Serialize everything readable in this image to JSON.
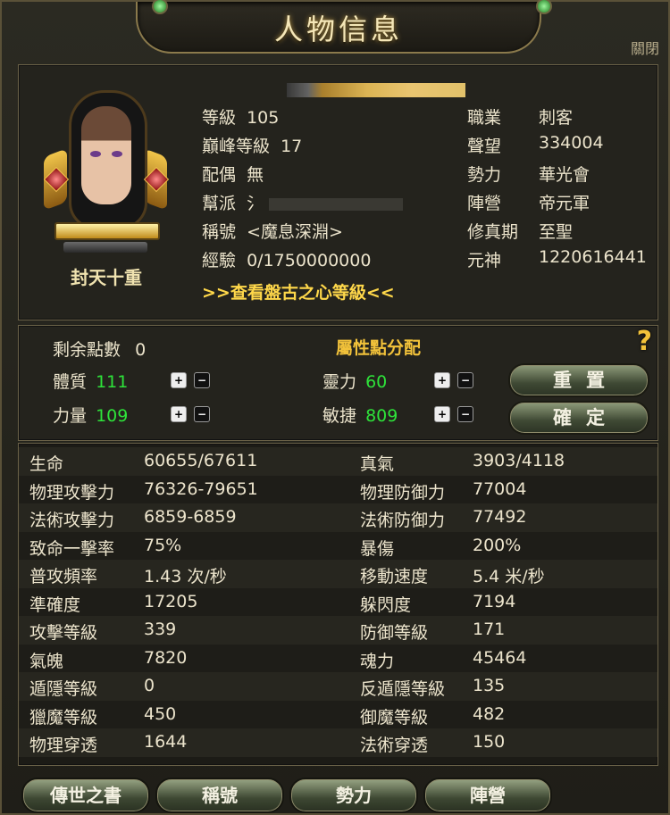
{
  "window": {
    "title": "人物信息",
    "close_label": "關閉"
  },
  "profile": {
    "rank_label": "封天十重",
    "left_fields": [
      {
        "label": "等級",
        "value": "105"
      },
      {
        "label": "巔峰等級",
        "value": "17"
      },
      {
        "label": "配偶",
        "value": "無"
      },
      {
        "label": "幫派",
        "value": "氵"
      },
      {
        "label": "稱號",
        "value": "<魔息深淵>"
      },
      {
        "label": "經驗",
        "value": "0/1750000000"
      }
    ],
    "right_fields": [
      {
        "label": "職業",
        "value": "刺客"
      },
      {
        "label": "聲望",
        "value": "334004"
      },
      {
        "label": "勢力",
        "value": "華光會"
      },
      {
        "label": "陣營",
        "value": "帝元軍"
      },
      {
        "label": "修真期",
        "value": "至聖"
      },
      {
        "label": "元神",
        "value": "1220616441"
      }
    ],
    "pangu_link": ">>查看盤古之心等級<<"
  },
  "attributes": {
    "remaining_label": "剩余點數",
    "remaining_value": "0",
    "section_title": "屬性點分配",
    "items": [
      {
        "label": "體質",
        "value": "111"
      },
      {
        "label": "力量",
        "value": "109"
      },
      {
        "label": "靈力",
        "value": "60"
      },
      {
        "label": "敏捷",
        "value": "809"
      }
    ],
    "plus": "+",
    "minus": "−",
    "help": "?",
    "reset_label": "重置",
    "confirm_label": "確定"
  },
  "stats": [
    {
      "l1": "生命",
      "v1": "60655/67611",
      "l2": "真氣",
      "v2": "3903/4118"
    },
    {
      "l1": "物理攻擊力",
      "v1": "76326-79651",
      "l2": "物理防御力",
      "v2": "77004"
    },
    {
      "l1": "法術攻擊力",
      "v1": "6859-6859",
      "l2": "法術防御力",
      "v2": "77492"
    },
    {
      "l1": "致命一擊率",
      "v1": "75%",
      "l2": "暴傷",
      "v2": "200%"
    },
    {
      "l1": "普攻頻率",
      "v1": "1.43 次/秒",
      "l2": "移動速度",
      "v2": "5.4 米/秒"
    },
    {
      "l1": "準確度",
      "v1": "17205",
      "l2": "躲閃度",
      "v2": "7194"
    },
    {
      "l1": "攻擊等級",
      "v1": "339",
      "l2": "防御等級",
      "v2": "171"
    },
    {
      "l1": "氣魄",
      "v1": "7820",
      "l2": "魂力",
      "v2": "45464"
    },
    {
      "l1": "遁隱等級",
      "v1": "0",
      "l2": "反遁隱等級",
      "v2": "135"
    },
    {
      "l1": "獵魔等級",
      "v1": "450",
      "l2": "御魔等級",
      "v2": "482"
    },
    {
      "l1": "物理穿透",
      "v1": "1644",
      "l2": "法術穿透",
      "v2": "150"
    }
  ],
  "bottom_buttons": [
    "傳世之書",
    "稱號",
    "勢力",
    "陣營"
  ]
}
